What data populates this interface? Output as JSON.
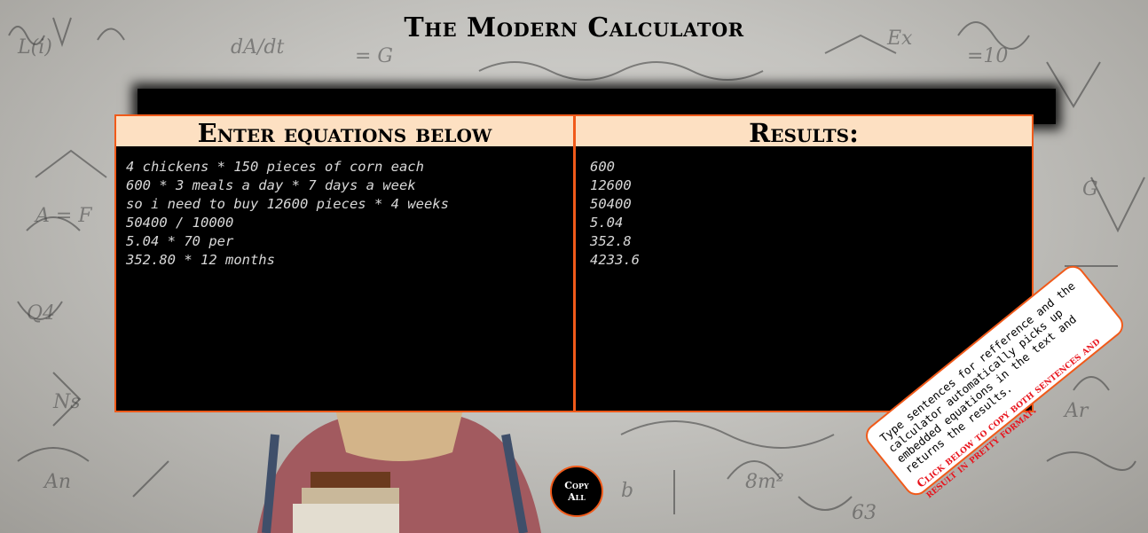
{
  "app": {
    "title": "The Modern Calculator"
  },
  "input_panel": {
    "heading": "Enter equations below",
    "lines": [
      "4 chickens * 150 pieces of corn each",
      "600 * 3 meals a day * 7 days a week",
      "so i need to buy 12600 pieces * 4 weeks",
      "50400 / 10000",
      "5.04 * 70 per",
      "352.80 * 12 months"
    ]
  },
  "results_panel": {
    "heading": "Results:",
    "lines": [
      "600",
      "12600",
      "50400",
      "5.04",
      "352.8",
      "4233.6"
    ]
  },
  "copy_button": {
    "label": "Copy All"
  },
  "info_note": {
    "text": "Type sentences for refference and the calculator automatically picks up embedded equations in the text and returns the results.",
    "click_hint": "Click below to copy both sentences and result in pretty format."
  },
  "colors": {
    "accent": "#f05a1a",
    "header_bg": "#fde0c2",
    "panel_bg": "#000000",
    "hint_red": "#e8131c"
  }
}
